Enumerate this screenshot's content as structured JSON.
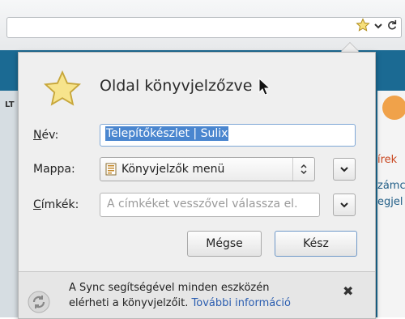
{
  "browser": {
    "star_icon": "star-icon",
    "dropdown_icon": "chevron-down-icon",
    "reload_icon": "reload-icon"
  },
  "page_behind": {
    "left_text": "LT",
    "right_texts": [
      "írek",
      "zámc",
      "egjel"
    ]
  },
  "dialog": {
    "title": "Oldal könyvjelzőzve",
    "name_label_prefix": "",
    "name_label_key": "N",
    "name_label_rest": "év:",
    "name_value": "Telepítőkészlet | Sulix",
    "folder_label": "Mappa:",
    "folder_value": "Könyvjelzők menü",
    "tags_label_key": "C",
    "tags_label_rest": "ímkék:",
    "tags_placeholder": "A címkéket vesszővel válassza el.",
    "cancel_label": "Mégse",
    "done_label": "Kész"
  },
  "footer": {
    "line1": "A Sync segítségével minden eszközén",
    "line2_text": "elérheti a könyvjelzőit.",
    "link_text": "További információ",
    "close_symbol": "✖"
  },
  "colors": {
    "accent": "#4a86cf",
    "link": "#2a5db0",
    "page_bg": "#1b6a93"
  }
}
